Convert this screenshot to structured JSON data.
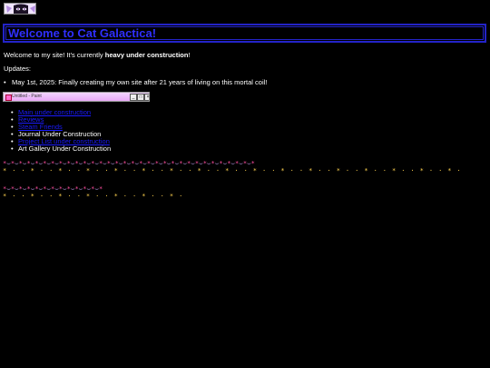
{
  "banner": {
    "alt": "anime banner"
  },
  "header": {
    "title": "Welcome to Cat Galactica!"
  },
  "intro": {
    "before": "Welcome to my site! It's currently ",
    "emphasis": "heavy under construction",
    "after": "!"
  },
  "updates": {
    "label": "Updates:",
    "items": [
      "May 1st, 2025: Finally creating my own site after 21 years of living on this mortal coil!"
    ]
  },
  "applet": {
    "title": "Untitled - Paint"
  },
  "nav": {
    "items": [
      {
        "label": "Main under construction",
        "link": true
      },
      {
        "label": "Reviews",
        "link": true
      },
      {
        "label": "Steam Friends",
        "link": true
      },
      {
        "label": "Journal Under Construction",
        "link": false
      },
      {
        "label": "Project List under construction",
        "link": true
      },
      {
        "label": "Art Gallery Under Construction",
        "link": false
      }
    ]
  },
  "colors": {
    "background": "#000000",
    "title": "#2f2fff",
    "title_border": "#2323c8",
    "link": "#1a1aff",
    "divider_star": "#ff4fa0",
    "divider_wave": "#c9a8ff",
    "divider_sparkle": "#ffd24f"
  },
  "dividers": {
    "pattern": "*⌣*⌣*⌣"
  }
}
